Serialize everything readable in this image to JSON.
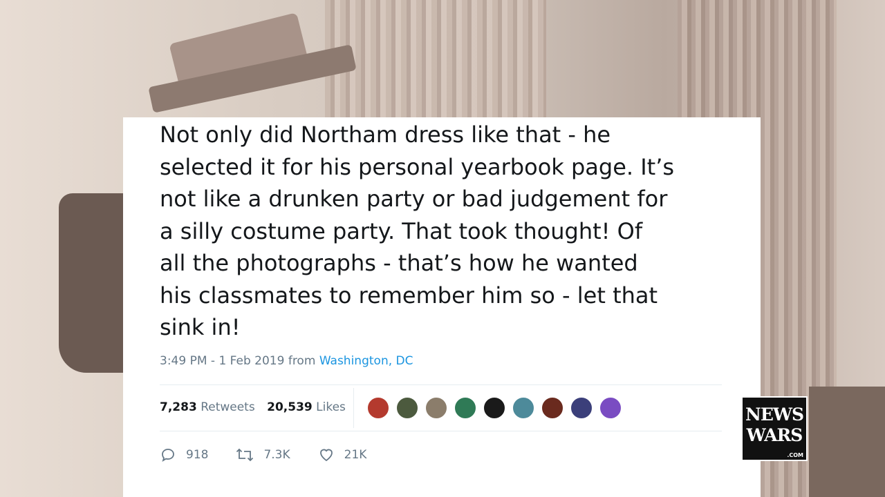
{
  "tweet": {
    "lines": [
      "Not only did Northam dress like that - he",
      "selected it for his personal yearbook page. It’s",
      "not like a drunken party or bad judgement for",
      "a silly costume party. That took thought! Of",
      "all the photographs - that’s how he wanted",
      "his classmates to remember him so - let that",
      "sink in!"
    ],
    "timestamp": "3:49 PM - 1 Feb 2019 from",
    "location": "Washington, DC",
    "retweets_count": "7,283",
    "retweets_label": "Retweets",
    "likes_count": "20,539",
    "likes_label": "Likes",
    "avatars": [
      "#b43a2e",
      "#4c5a3e",
      "#8b7d6b",
      "#2f7a56",
      "#1a1a1a",
      "#4d8a9a",
      "#6a2a1e",
      "#3b3f7a",
      "#7a4cc2"
    ],
    "actions": {
      "replies": "918",
      "retweets": "7.3K",
      "likes": "21K"
    }
  },
  "logo": {
    "line1": "NEWS",
    "line2": "WARS",
    "line3": ".COM"
  },
  "colors": {
    "link": "#1b95e0",
    "muted": "#657786",
    "text": "#14171a"
  }
}
